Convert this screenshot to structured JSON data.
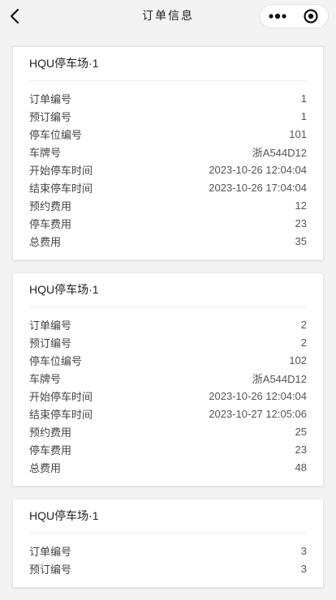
{
  "nav": {
    "title": "订单信息"
  },
  "field_labels": {
    "order_no": "订单编号",
    "reservation_no": "预订编号",
    "space_no": "停车位编号",
    "plate": "车牌号",
    "start_time": "开始停车时间",
    "end_time": "结束停车时间",
    "reservation_fee": "预约费用",
    "parking_fee": "停车费用",
    "total_fee": "总费用"
  },
  "orders": [
    {
      "lot_name": "HQU停车场·1",
      "order_no": "1",
      "reservation_no": "1",
      "space_no": "101",
      "plate": "浙A544D12",
      "start_time": "2023-10-26 12:04:04",
      "end_time": "2023-10-26 17:04:04",
      "reservation_fee": "12",
      "parking_fee": "23",
      "total_fee": "35"
    },
    {
      "lot_name": "HQU停车场·1",
      "order_no": "2",
      "reservation_no": "2",
      "space_no": "102",
      "plate": "浙A544D12",
      "start_time": "2023-10-26 12:04:04",
      "end_time": "2023-10-27 12:05:06",
      "reservation_fee": "25",
      "parking_fee": "23",
      "total_fee": "48"
    },
    {
      "lot_name": "HQU停车场·1",
      "order_no": "3",
      "reservation_no": "3"
    }
  ]
}
